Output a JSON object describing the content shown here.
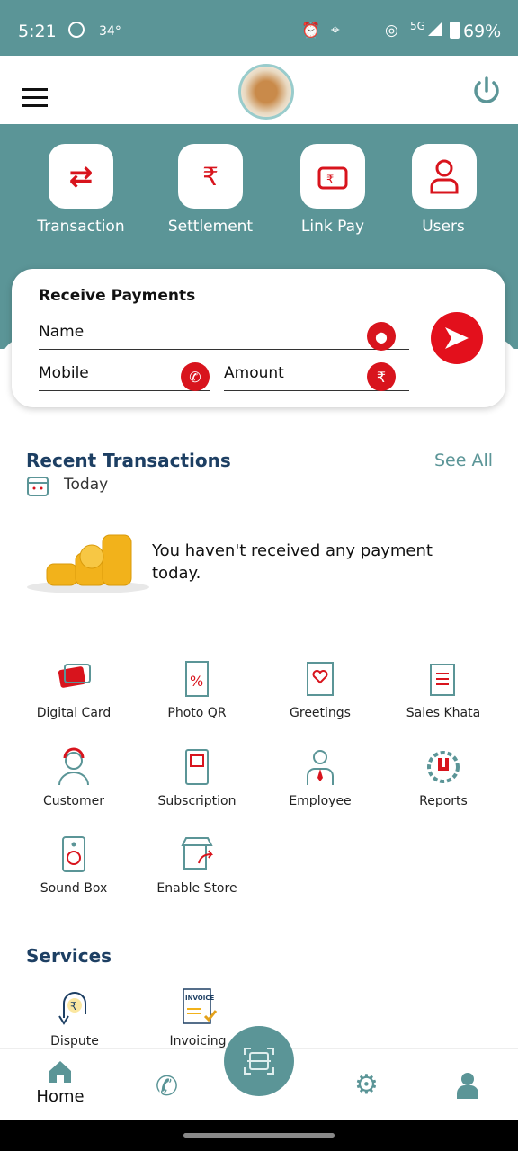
{
  "status_bar": {
    "time": "5:21",
    "temp": "34°",
    "network": "5G",
    "battery": "69%"
  },
  "header": {
    "menu_icon": "hamburger-icon",
    "logo": "emblem-logo",
    "power_icon": "power-icon"
  },
  "quick_actions": [
    {
      "label": "Transaction",
      "icon": "transfer-icon"
    },
    {
      "label": "Settlement",
      "icon": "settlement-icon"
    },
    {
      "label": "Link Pay",
      "icon": "wallet-icon"
    },
    {
      "label": "Users",
      "icon": "user-icon"
    }
  ],
  "receive": {
    "title": "Receive Payments",
    "name_placeholder": "Name",
    "mobile_placeholder": "Mobile",
    "amount_placeholder": "Amount"
  },
  "recent": {
    "title": "Recent Transactions",
    "see_all": "See All",
    "period": "Today",
    "empty": "You haven't received any payment today."
  },
  "grid": [
    {
      "label": "Digital Card"
    },
    {
      "label": "Photo QR"
    },
    {
      "label": "Greetings"
    },
    {
      "label": "Sales Khata"
    },
    {
      "label": "Customer"
    },
    {
      "label": "Subscription"
    },
    {
      "label": "Employee"
    },
    {
      "label": "Reports"
    },
    {
      "label": "Sound Box"
    },
    {
      "label": "Enable Store"
    }
  ],
  "services": {
    "title": "Services",
    "items": [
      {
        "label": "Dispute"
      },
      {
        "label": "Invoicing"
      }
    ]
  },
  "nav": {
    "home": "Home"
  },
  "colors": {
    "teal": "#5b9597",
    "red": "#d8141d",
    "navy": "#1d3f63"
  }
}
